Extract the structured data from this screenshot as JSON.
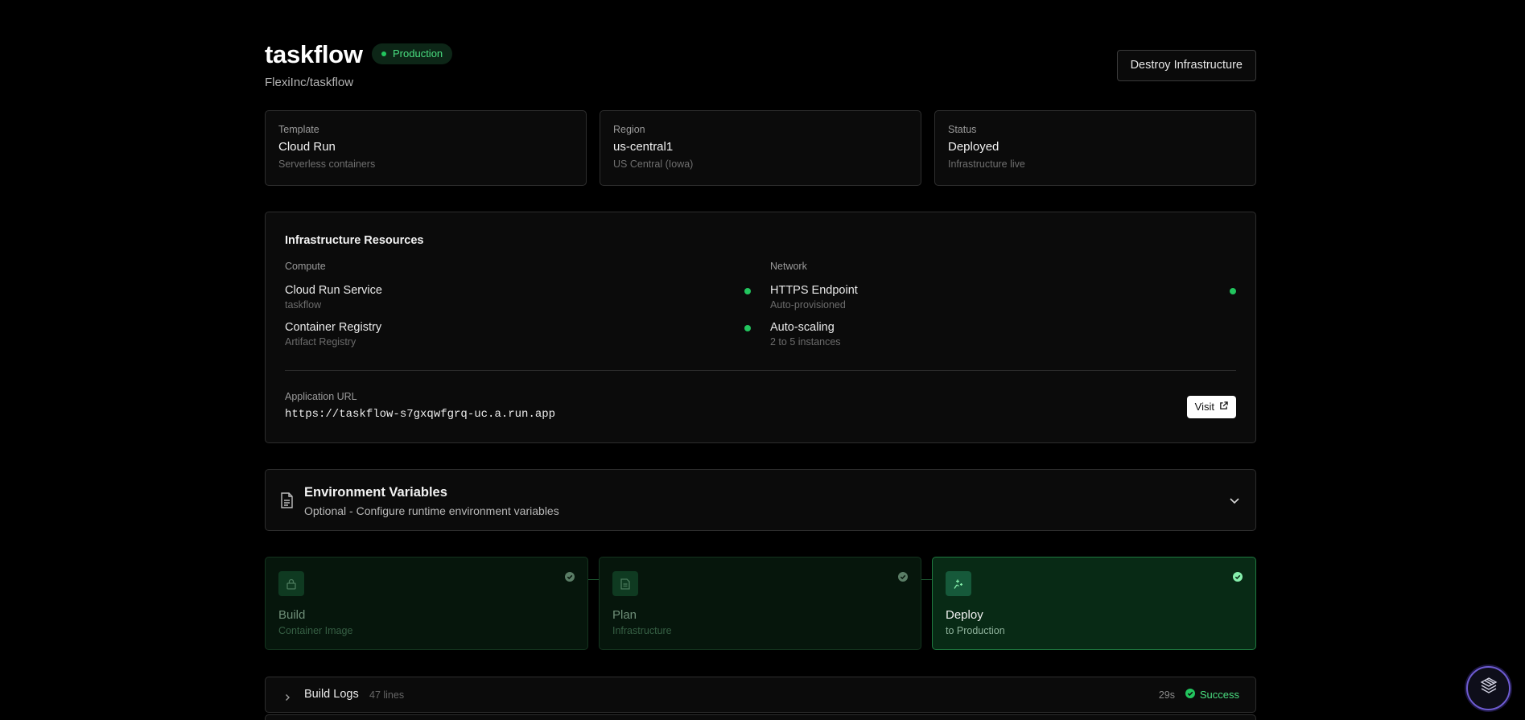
{
  "project": {
    "name": "taskflow",
    "env_badge": "Production",
    "repo": "FlexiInc/taskflow",
    "destroy_label": "Destroy Infrastructure"
  },
  "cards": [
    {
      "label": "Template",
      "value": "Cloud Run",
      "sub": "Serverless containers"
    },
    {
      "label": "Region",
      "value": "us-central1",
      "sub": "US Central (Iowa)"
    },
    {
      "label": "Status",
      "value": "Deployed",
      "sub": "Infrastructure live"
    }
  ],
  "resources": {
    "title": "Infrastructure Resources",
    "compute": {
      "heading": "Compute",
      "items": [
        {
          "name": "Cloud Run Service",
          "sub": "taskflow",
          "status": "active"
        },
        {
          "name": "Container Registry",
          "sub": "Artifact Registry",
          "status": "active"
        }
      ]
    },
    "network": {
      "heading": "Network",
      "items": [
        {
          "name": "HTTPS Endpoint",
          "sub": "Auto-provisioned",
          "status": "active"
        },
        {
          "name": "Auto-scaling",
          "sub": "2 to 5 instances",
          "status": "none"
        }
      ]
    },
    "url_label": "Application URL",
    "url": "https://taskflow-s7gxqwfgrq-uc.a.run.app",
    "visit_label": "Visit"
  },
  "env": {
    "title": "Environment Variables",
    "desc": "Optional - Configure runtime environment variables"
  },
  "pipeline": [
    {
      "name": "Build",
      "sub": "Container Image",
      "icon": "lock-icon",
      "state": "done"
    },
    {
      "name": "Plan",
      "sub": "Infrastructure",
      "icon": "document-icon",
      "state": "done"
    },
    {
      "name": "Deploy",
      "sub": "to Production",
      "icon": "sparkle-icon",
      "state": "current"
    }
  ],
  "logs": {
    "title": "Build Logs",
    "count": "47 lines",
    "duration": "29s",
    "status": "Success"
  },
  "colors": {
    "accent": "#22c55e",
    "background": "#000000",
    "border": "#2e2e2e",
    "fab_ring": "#6d5bd0"
  }
}
